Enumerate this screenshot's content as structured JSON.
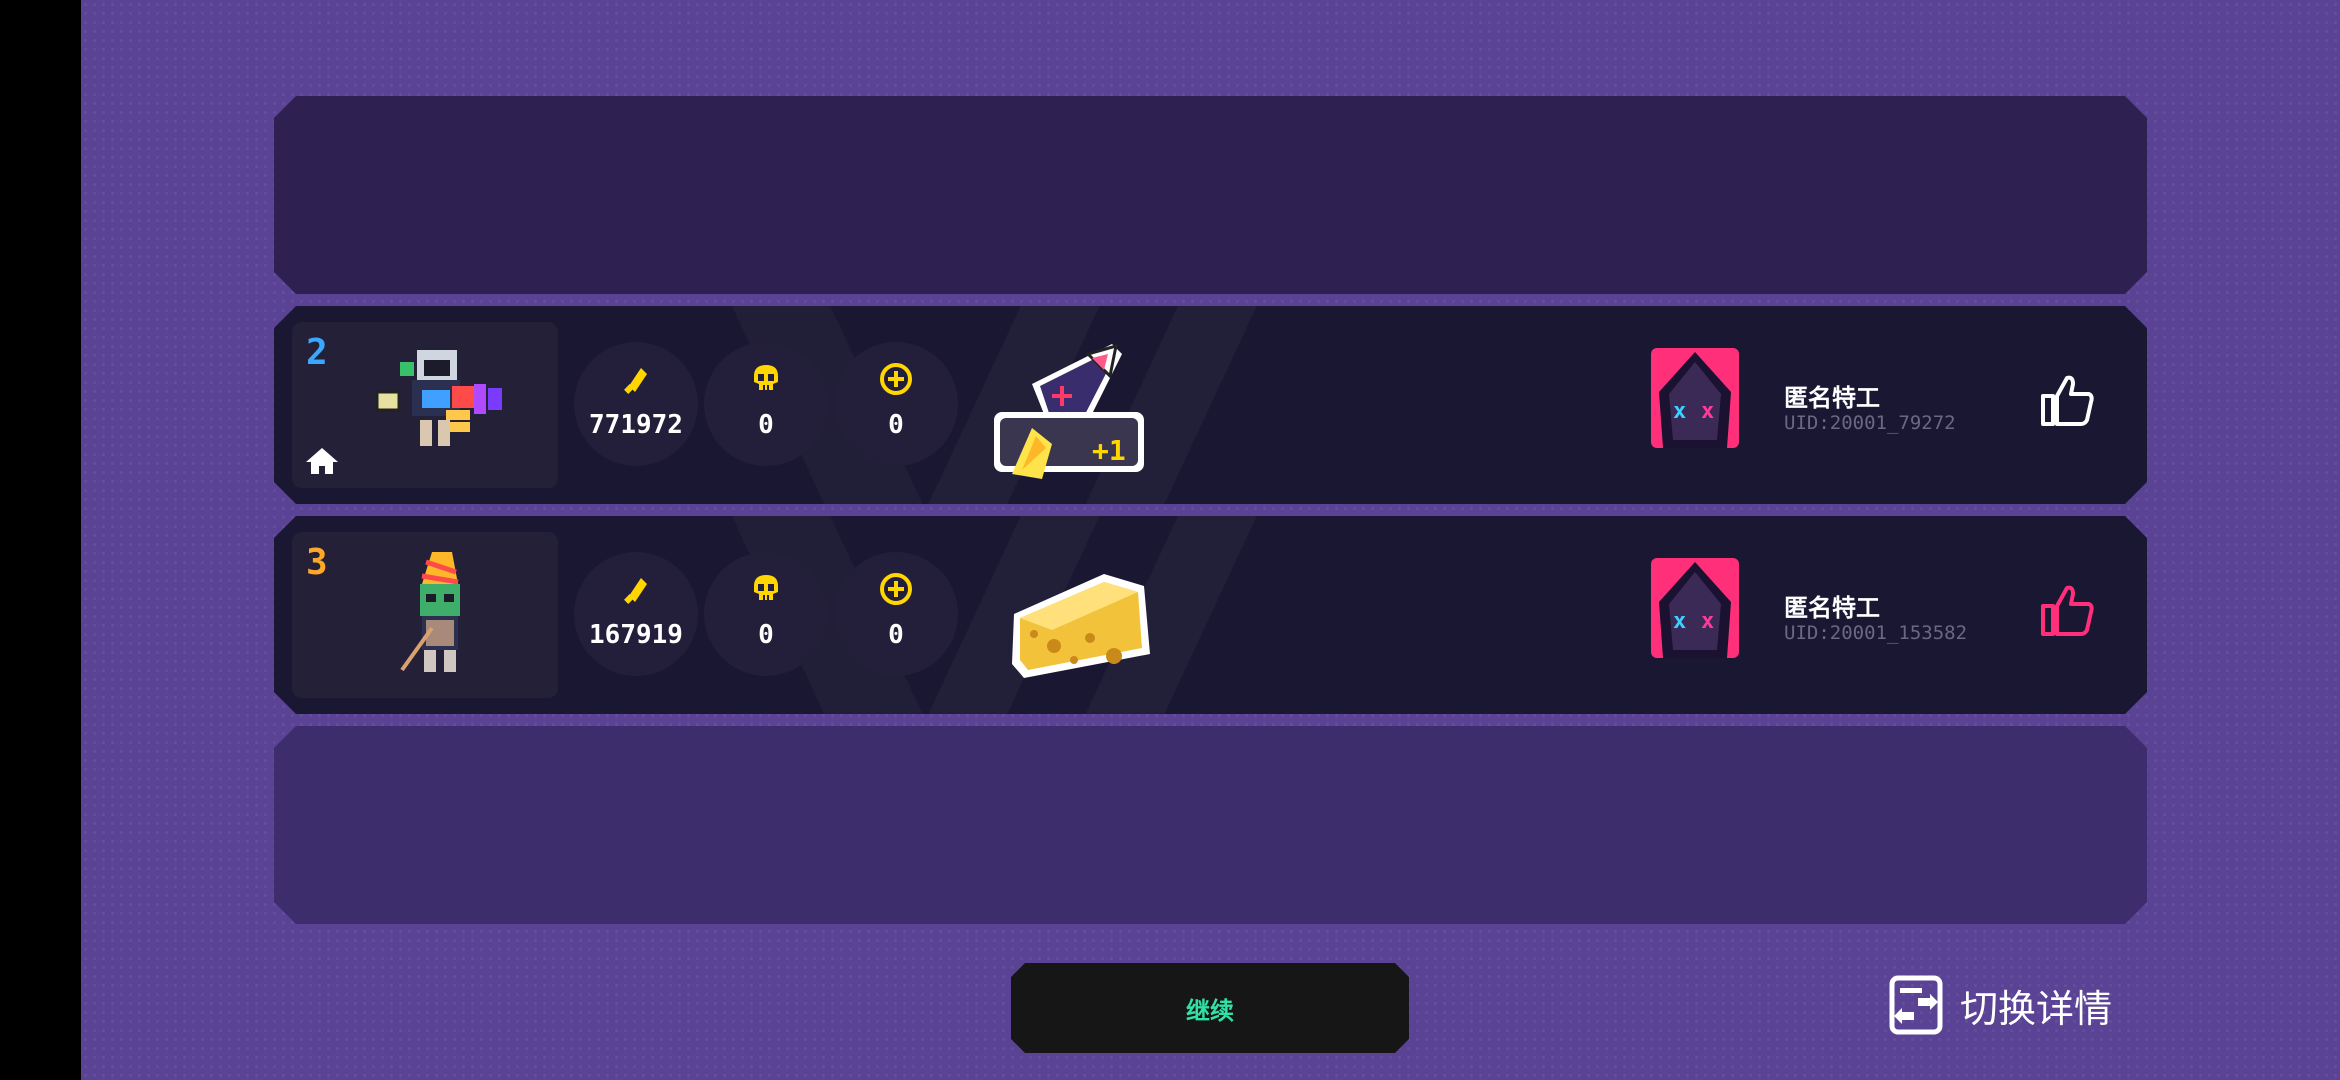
{
  "colors": {
    "background": "#5a4294",
    "rank2": "#3aa8ff",
    "rank3": "#ffa726",
    "stat_icon": "#ffd600",
    "continue_text": "#31e0a4",
    "avatar_bg": "#ff2f7a",
    "like_active": "#ff2f7a"
  },
  "rows": [
    {
      "rank": "2",
      "home_badge": true,
      "character": "armored-gunner-sprite",
      "stats": {
        "ammo": "771972",
        "kills": "0",
        "revives": "0"
      },
      "item": "shark-rocket-icon",
      "item_badge": "+1",
      "player": {
        "name": "匿名特工",
        "uid": "UID:20001_79272"
      },
      "like_state": "not-liked"
    },
    {
      "rank": "3",
      "home_badge": false,
      "character": "party-hat-zombie-sprite",
      "stats": {
        "ammo": "167919",
        "kills": "0",
        "revives": "0"
      },
      "item": "cheese-icon",
      "player": {
        "name": "匿名特工",
        "uid": "UID:20001_153582"
      },
      "like_state": "liked"
    }
  ],
  "footer": {
    "continue_label": "继续",
    "switch_label": "切换详情"
  }
}
